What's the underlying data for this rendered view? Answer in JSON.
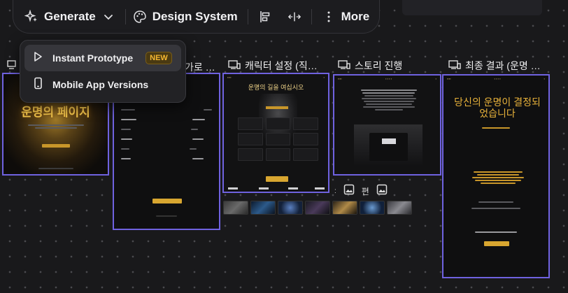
{
  "toolbar": {
    "generate_label": "Generate",
    "design_system_label": "Design System",
    "more_label": "More",
    "icons": [
      "sparkle-icon",
      "chevron-down-icon",
      "palette-icon",
      "align-icon",
      "distribute-icon",
      "more-dots-icon"
    ]
  },
  "dropdown": {
    "items": [
      {
        "label": "Instant Prototype",
        "badge": "NEW",
        "icon": "play-icon"
      },
      {
        "label": "Mobile App Versions",
        "icon": "phone-icon"
      }
    ]
  },
  "frames": [
    {
      "title": "",
      "hero_text": "운명의 페이지"
    },
    {
      "title": "가로 …"
    },
    {
      "title": "캐릭터 설정 (직…",
      "heading": "운명의 길을 여십시오"
    },
    {
      "title": "스토리 진행"
    },
    {
      "title": "최종 결과 (운명 …",
      "heading": "당신의 운명이 결정되었습니다"
    }
  ],
  "small_icon_label": "편",
  "colors": {
    "canvas": "#19191b",
    "selection": "#6f62e0",
    "accent_gold": "#e8b23a",
    "badge_text": "#f5b731"
  }
}
